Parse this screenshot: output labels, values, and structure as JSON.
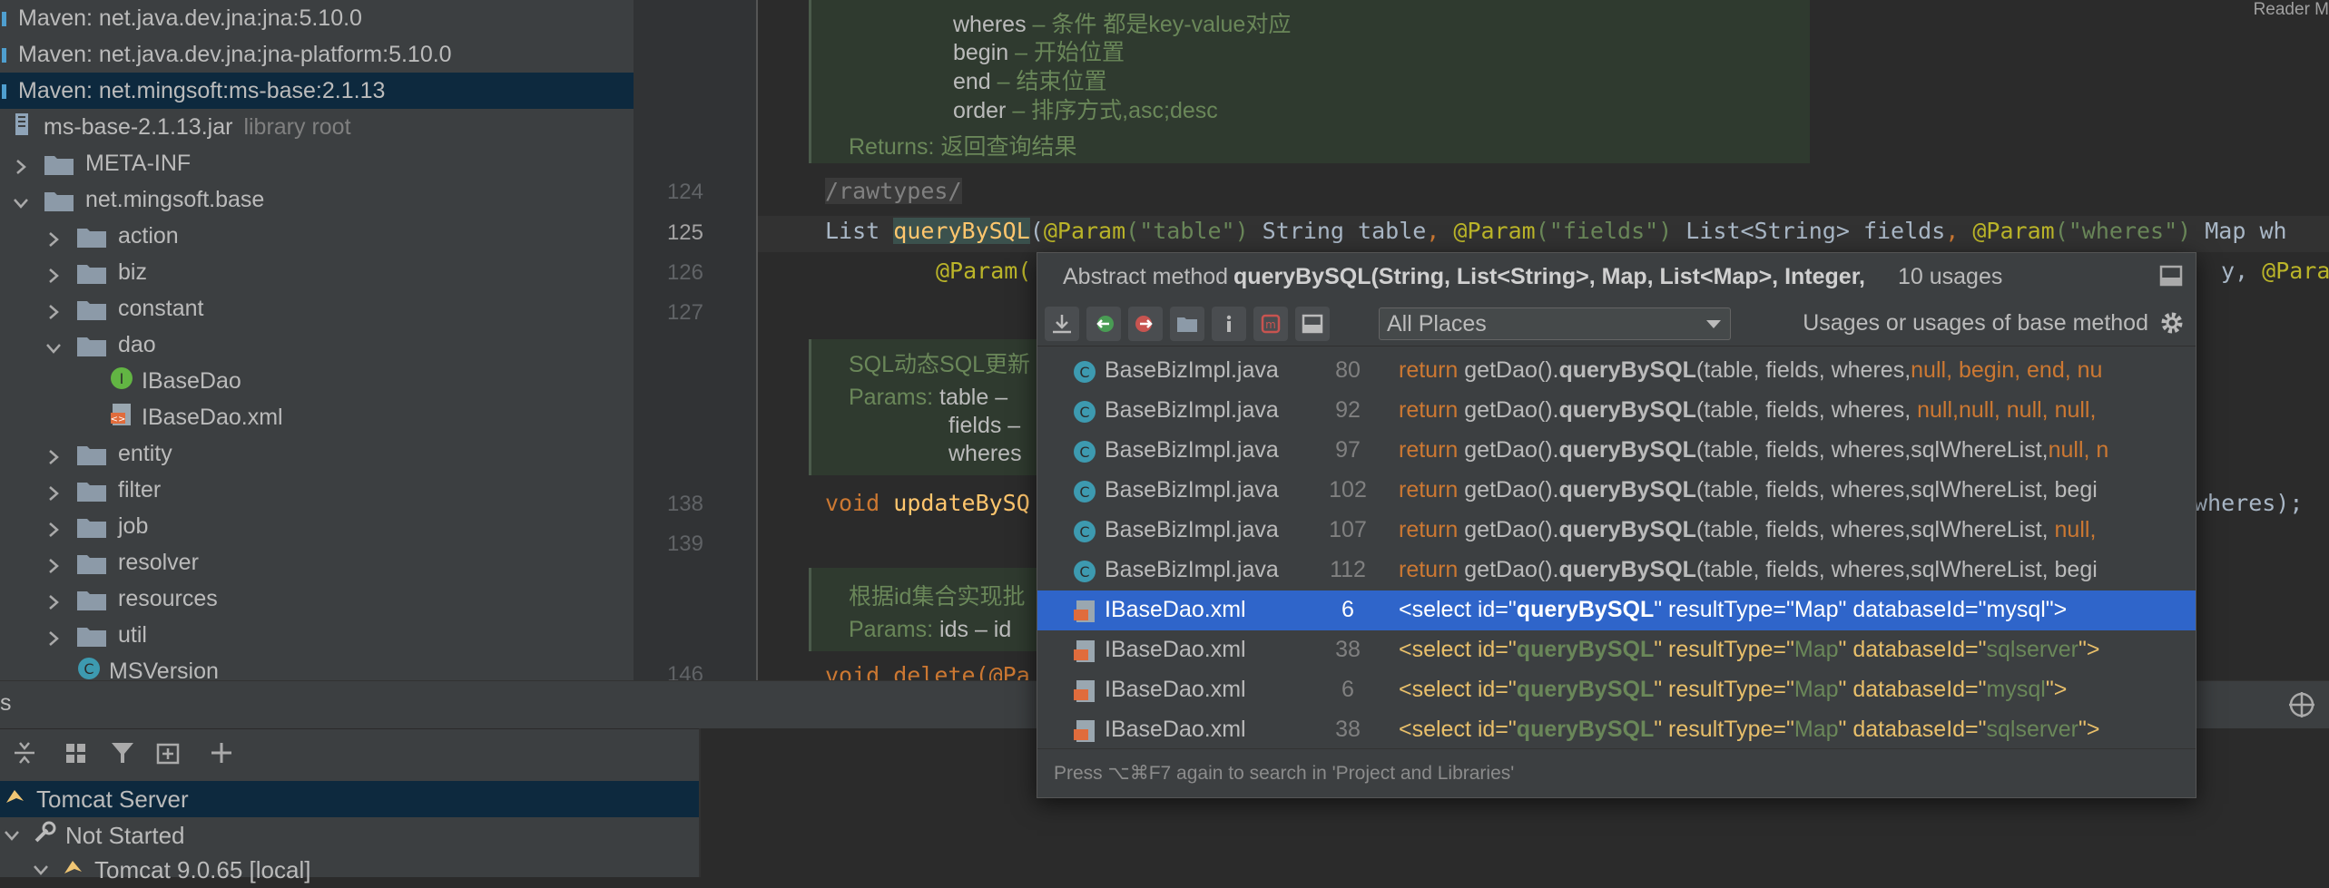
{
  "project_tree": {
    "items": [
      {
        "label": "Maven: net.java.dev.jna:jna:5.10.0",
        "kind": "library"
      },
      {
        "label": "Maven: net.java.dev.jna:jna-platform:5.10.0",
        "kind": "library"
      },
      {
        "label": "Maven: net.mingsoft:ms-base:2.1.13",
        "kind": "library",
        "selected": true
      },
      {
        "label": "ms-base-2.1.13.jar",
        "suffix": "library root",
        "kind": "jar"
      },
      {
        "label": "META-INF",
        "kind": "folder",
        "expanded": false
      },
      {
        "label": "net.mingsoft.base",
        "kind": "folder",
        "expanded": true
      },
      {
        "label": "action",
        "kind": "folder",
        "expanded": false
      },
      {
        "label": "biz",
        "kind": "folder",
        "expanded": false
      },
      {
        "label": "constant",
        "kind": "folder",
        "expanded": false
      },
      {
        "label": "dao",
        "kind": "folder",
        "expanded": true
      },
      {
        "label": "IBaseDao",
        "kind": "interface"
      },
      {
        "label": "IBaseDao.xml",
        "kind": "xml"
      },
      {
        "label": "entity",
        "kind": "folder",
        "expanded": false
      },
      {
        "label": "filter",
        "kind": "folder",
        "expanded": false
      },
      {
        "label": "job",
        "kind": "folder",
        "expanded": false
      },
      {
        "label": "resolver",
        "kind": "folder",
        "expanded": false
      },
      {
        "label": "resources",
        "kind": "folder",
        "expanded": false
      },
      {
        "label": "util",
        "kind": "folder",
        "expanded": false
      },
      {
        "label": "MSVersion",
        "kind": "class"
      }
    ]
  },
  "editor": {
    "reader_mode": "Reader M",
    "doc_block_1": {
      "params": [
        {
          "name": "wheres",
          "desc": "– 条件 都是key-value对应"
        },
        {
          "name": "begin",
          "desc": "– 开始位置"
        },
        {
          "name": "end",
          "desc": "– 结束位置"
        },
        {
          "name": "order",
          "desc": "– 排序方式,asc;desc"
        }
      ],
      "returns_label": "Returns:",
      "returns_text": "返回查询结果"
    },
    "line_numbers": [
      "124",
      "125",
      "126",
      "127",
      "138",
      "139",
      "146"
    ],
    "line_124": "/rawtypes/",
    "line_125": {
      "t1": "List ",
      "method": "queryBySQL",
      "t2": "(",
      "a1": "@Param",
      "s1": "(\"table\")",
      "t3": " String table",
      "c1": ", ",
      "a2": "@Param",
      "s2": "(\"fields\")",
      "t4": " List<String> fields",
      "c2": ", ",
      "a3": "@Param",
      "s3": "(\"wheres\")",
      "t5": " Map wh"
    },
    "line_126_left": "@Param(",
    "line_126_right_tail": "y, ",
    "line_126_right_ann": "@Param",
    "doc_block_2": {
      "title": "SQL动态SQL更新",
      "params_label": "Params:",
      "params": [
        "table – ",
        "fields – ",
        "wheres "
      ]
    },
    "line_138": {
      "kw": "void ",
      "method": "updateBySQ",
      "tail": "wheres);"
    },
    "doc_block_3": {
      "title": "根据id集合实现批",
      "params_label": "Params:",
      "param": "ids – id"
    },
    "line_146": "void delete(@Pa"
  },
  "usages_popup": {
    "header_prefix": "Abstract method ",
    "header_method": "queryBySQL(String, List<String>, Map, List<Map>, Integer,",
    "usage_count": "10 usages",
    "scope": "All Places",
    "filter_label": "Usages or usages of base method",
    "rows": [
      {
        "file": "BaseBizImpl.java",
        "line": "80",
        "kind": "java",
        "kw": "return ",
        "pre": "getDao().",
        "m": "queryBySQL",
        "post": "(table, fields, wheres,",
        "post_kw": "null",
        "tail": ",  begin, end, nu"
      },
      {
        "file": "BaseBizImpl.java",
        "line": "92",
        "kind": "java",
        "kw": "return ",
        "pre": "getDao().",
        "m": "queryBySQL",
        "post": "(table, fields, wheres, ",
        "post_kw": "null,null,  null, null,",
        "tail": ""
      },
      {
        "file": "BaseBizImpl.java",
        "line": "97",
        "kind": "java",
        "kw": "return ",
        "pre": "getDao().",
        "m": "queryBySQL",
        "post": "(table, fields, wheres,sqlWhereList,",
        "post_kw": "null,",
        "tail": "  n"
      },
      {
        "file": "BaseBizImpl.java",
        "line": "102",
        "kind": "java",
        "kw": "return ",
        "pre": "getDao().",
        "m": "queryBySQL",
        "post": "(table, fields, wheres,sqlWhereList,  begi",
        "post_kw": "",
        "tail": ""
      },
      {
        "file": "BaseBizImpl.java",
        "line": "107",
        "kind": "java",
        "kw": "return ",
        "pre": "getDao().",
        "m": "queryBySQL",
        "post": "(table, fields, wheres,sqlWhereList,  ",
        "post_kw": "null,",
        "tail": " "
      },
      {
        "file": "BaseBizImpl.java",
        "line": "112",
        "kind": "java",
        "kw": "return ",
        "pre": "getDao().",
        "m": "queryBySQL",
        "post": "(table, fields, wheres,sqlWhereList,  begi",
        "post_kw": "",
        "tail": ""
      },
      {
        "file": "IBaseDao.xml",
        "line": "6",
        "kind": "xml",
        "selected": true,
        "x1": "<select id=\"",
        "m": "queryBySQL",
        "x2": "\" resultType=\"Map\" databaseId=\"mysql\">"
      },
      {
        "file": "IBaseDao.xml",
        "line": "38",
        "kind": "xml",
        "x1": "<select id=\"",
        "m": "queryBySQL",
        "x2a": "\" resultType=\"",
        "x2b": "Map",
        "x2c": "\" databaseId=\"",
        "x2d": "sqlserver",
        "x2e": "\">"
      },
      {
        "file": "IBaseDao.xml",
        "line": "6",
        "kind": "xml",
        "x1": "<select id=\"",
        "m": "queryBySQL",
        "x2a": "\" resultType=\"",
        "x2b": "Map",
        "x2c": "\" databaseId=\"",
        "x2d": "mysql",
        "x2e": "\">"
      },
      {
        "file": "IBaseDao.xml",
        "line": "38",
        "kind": "xml",
        "x1": "<select id=\"",
        "m": "queryBySQL",
        "x2a": "\" resultType=\"",
        "x2b": "Map",
        "x2c": "\" databaseId=\"",
        "x2d": "sqlserver",
        "x2e": "\">"
      }
    ],
    "footer": "Press ⌥⌘F7 again to search in 'Project and Libraries'"
  },
  "services_panel": {
    "tab_fragment": "s",
    "items": [
      {
        "label": "Tomcat Server",
        "selected": true
      },
      {
        "label": "Not Started"
      },
      {
        "label": "Tomcat 9.0.65 [local]"
      }
    ]
  },
  "colors": {
    "selection_tree": "#0d293e",
    "selection_popup": "#2f65ca",
    "keyword": "#cc7832",
    "annotation": "#bbb529",
    "string": "#6a8759",
    "method_highlight": "#ffc66d"
  }
}
